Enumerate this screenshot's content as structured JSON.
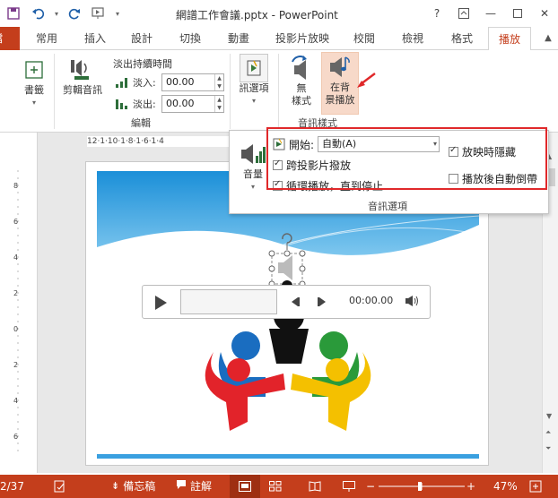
{
  "window": {
    "title": "網譜工作會議.pptx - PowerPoint",
    "help": "?",
    "controls": [
      "restore",
      "minimize",
      "maximize",
      "close"
    ]
  },
  "quick_access": [
    "save-icon",
    "undo-icon",
    "redo-icon",
    "slideshow-icon",
    "customize-icon"
  ],
  "tabs": {
    "file": "檔案",
    "items": [
      "常用",
      "插入",
      "設計",
      "切換",
      "動畫",
      "投影片放映",
      "校閱",
      "檢視",
      "格式",
      "播放"
    ],
    "active": "播放"
  },
  "ribbon": {
    "bookmark_label": "書籤",
    "trim_label": "剪輯音訊",
    "fade_title": "淡出持續時間",
    "fade_in_label": "淡入:",
    "fade_in_value": "00.00",
    "fade_out_label": "淡出:",
    "fade_out_value": "00.00",
    "edit_group": "編輯",
    "audio_options_label": "訊選項",
    "no_style_line1": "無",
    "no_style_line2": "樣式",
    "bg_play_line1": "在背",
    "bg_play_line2": "景播放",
    "audio_style_group": "音訊樣式"
  },
  "dropdown": {
    "volume_label": "音量",
    "start_label": "開始:",
    "start_value": "自動(A)",
    "across_slides": "跨投影片撥放",
    "across_slides_checked": true,
    "loop": "循環播放，直到停止",
    "loop_checked": true,
    "hide_during_show": "放映時隱藏",
    "hide_during_show_checked": true,
    "rewind": "播放後自動倒帶",
    "rewind_checked": false,
    "group_label": "音訊選項"
  },
  "ruler": {
    "h_text": "12·1·10·1·8·1·6·1·4"
  },
  "player": {
    "time": "00:00.00"
  },
  "statusbar": {
    "slide": "2/37",
    "notes": "備忘稿",
    "comments": "註解",
    "zoom": "47%"
  },
  "colors": {
    "accent": "#c43e1c",
    "highlight": "#e0282a"
  }
}
